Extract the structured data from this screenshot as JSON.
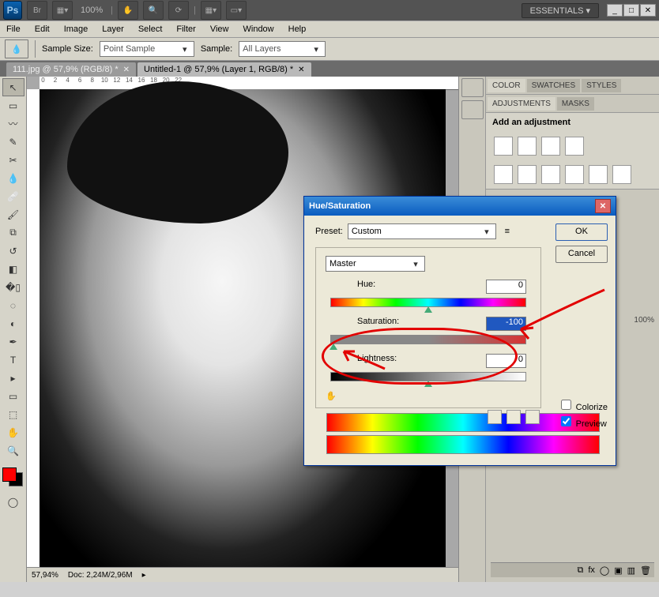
{
  "topbar": {
    "zoom": "100%",
    "essentials": "ESSENTIALS"
  },
  "menu": {
    "file": "File",
    "edit": "Edit",
    "image": "Image",
    "layer": "Layer",
    "select": "Select",
    "filter": "Filter",
    "view": "View",
    "window": "Window",
    "help": "Help"
  },
  "options": {
    "sample_size_label": "Sample Size:",
    "sample_size_value": "Point Sample",
    "sample_label": "Sample:",
    "sample_value": "All Layers"
  },
  "tabs": {
    "tab1": "111.jpg @ 57,9% (RGB/8) *",
    "tab2": "Untitled-1 @ 57,9% (Layer 1, RGB/8) *"
  },
  "panels": {
    "color": "COLOR",
    "swatches": "SWATCHES",
    "styles": "STYLES",
    "adjustments": "ADJUSTMENTS",
    "masks": "MASKS",
    "add_adjustment": "Add an adjustment",
    "opacity": "100%"
  },
  "status": {
    "zoom": "57,94%",
    "doc": "Doc: 2,24M/2,96M"
  },
  "dialog": {
    "title": "Hue/Saturation",
    "preset_label": "Preset:",
    "preset_value": "Custom",
    "channel": "Master",
    "hue_label": "Hue:",
    "hue_value": "0",
    "sat_label": "Saturation:",
    "sat_value": "-100",
    "light_label": "Lightness:",
    "light_value": "0",
    "ok": "OK",
    "cancel": "Cancel",
    "colorize": "Colorize",
    "preview": "Preview"
  }
}
